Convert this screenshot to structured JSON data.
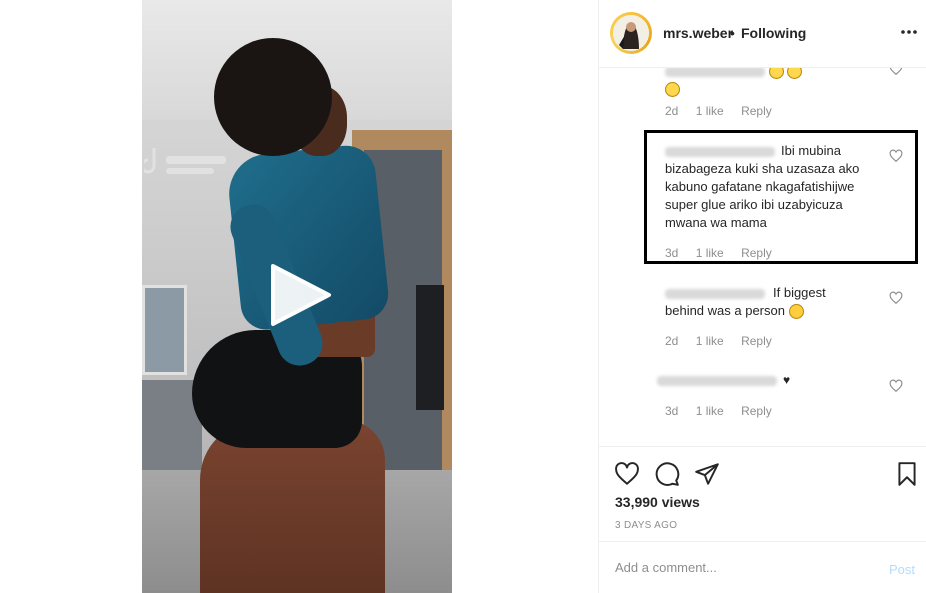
{
  "header": {
    "username": "mrs.weber",
    "separator": "•",
    "follow_status": "Following",
    "more_icon": "more-options-icon"
  },
  "media": {
    "play_icon": "play-icon"
  },
  "comments": [
    {
      "text_visible": "",
      "time": "2d",
      "likes": "1 like",
      "reply": "Reply"
    },
    {
      "text_visible": "Ibi mubina bizabageza kuki sha uzasaza ako kabuno gafatane nkagafatishijwe super glue ariko ibi uzabyicuza mwana wa mama",
      "time": "3d",
      "likes": "1 like",
      "reply": "Reply",
      "highlighted": true
    },
    {
      "text_visible": "If biggest behind was a person",
      "time": "2d",
      "likes": "1 like",
      "reply": "Reply"
    },
    {
      "text_visible": "♥",
      "time": "3d",
      "likes": "1 like",
      "reply": "Reply"
    }
  ],
  "actions": {
    "like_icon": "heart-icon",
    "comment_icon": "comment-bubble-icon",
    "share_icon": "paper-plane-icon",
    "save_icon": "bookmark-icon",
    "views": "33,990 views",
    "posted": "3 DAYS AGO"
  },
  "add_comment": {
    "placeholder": "Add a comment...",
    "post_label": "Post"
  },
  "colors": {
    "text": "#262626",
    "muted": "#8e8e8e",
    "post_disabled": "#b3dbff",
    "highlight_border": "#000000"
  }
}
